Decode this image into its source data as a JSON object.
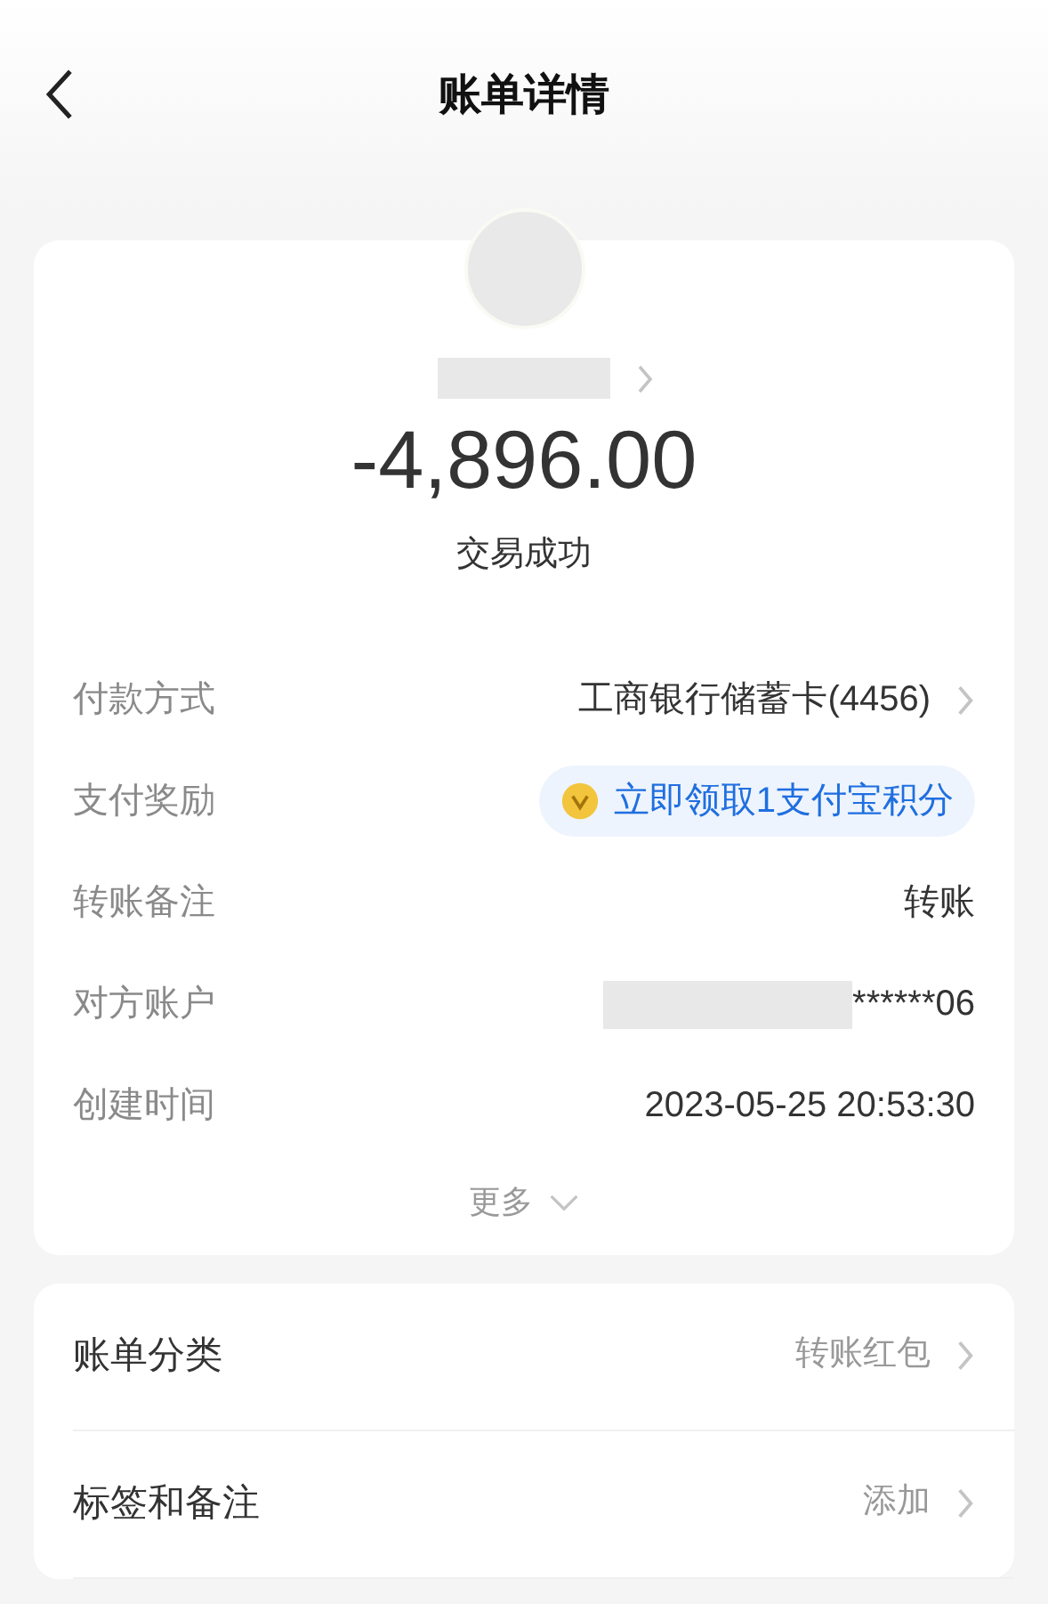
{
  "header": {
    "title": "账单详情"
  },
  "summary": {
    "amount": "-4,896.00",
    "status": "交易成功"
  },
  "details": [
    {
      "kind": "link",
      "label": "付款方式",
      "value": "工商银行储蓄卡(4456)"
    },
    {
      "kind": "reward",
      "label": "支付奖励",
      "value": "立即领取1支付宝积分"
    },
    {
      "kind": "text",
      "label": "转账备注",
      "value": "转账"
    },
    {
      "kind": "masked",
      "label": "对方账户",
      "value": "******06"
    },
    {
      "kind": "text",
      "label": "创建时间",
      "value": "2023-05-25 20:53:30"
    }
  ],
  "more": {
    "label": "更多"
  },
  "settings": [
    {
      "label": "账单分类",
      "value": "转账红包"
    },
    {
      "label": "标签和备注",
      "value": "添加"
    }
  ]
}
